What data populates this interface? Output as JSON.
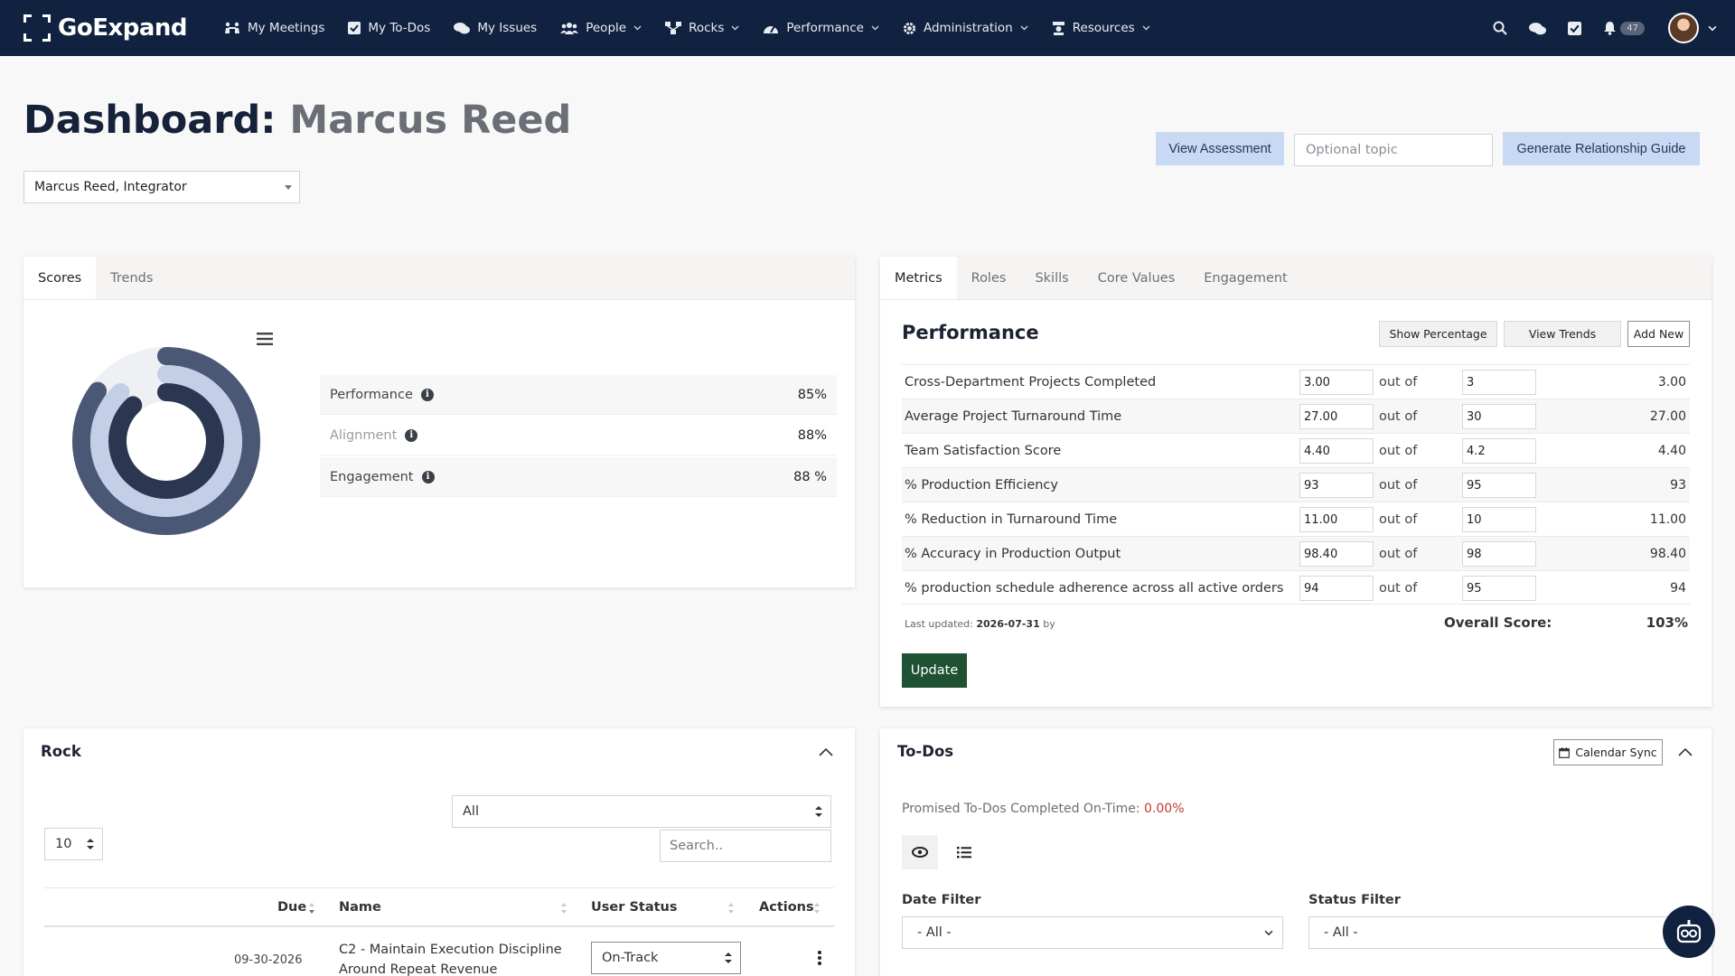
{
  "brand": {
    "name": "GoExpand"
  },
  "nav": {
    "items": [
      {
        "label": "My Meetings",
        "icon": "meetings-icon"
      },
      {
        "label": "My To-Dos",
        "icon": "checkbox-icon"
      },
      {
        "label": "My Issues",
        "icon": "chat-icon"
      },
      {
        "label": "People",
        "icon": "people-icon",
        "dropdown": true
      },
      {
        "label": "Rocks",
        "icon": "hierarchy-icon",
        "dropdown": true
      },
      {
        "label": "Performance",
        "icon": "gauge-icon",
        "dropdown": true
      },
      {
        "label": "Administration",
        "icon": "gear-icon",
        "dropdown": true
      },
      {
        "label": "Resources",
        "icon": "resources-icon",
        "dropdown": true
      }
    ],
    "notification_count": "47"
  },
  "header": {
    "title_prefix": "Dashboard:",
    "title_name": "Marcus Reed",
    "user_select": "Marcus Reed, Integrator",
    "view_assessment": "View Assessment",
    "topic_placeholder": "Optional topic",
    "generate_guide": "Generate Relationship Guide"
  },
  "scores": {
    "tabs": [
      "Scores",
      "Trends"
    ],
    "rows": [
      {
        "label": "Performance",
        "value": "85%"
      },
      {
        "label": "Alignment",
        "value": "88%"
      },
      {
        "label": "Engagement",
        "value": "88 %"
      }
    ],
    "ring_colors": [
      "#4a5876",
      "#c3cfe6",
      "#2b3650"
    ],
    "ring_levels": [
      0.85,
      0.88,
      0.88
    ]
  },
  "metrics": {
    "tabs": [
      "Metrics",
      "Roles",
      "Skills",
      "Core Values",
      "Engagement"
    ],
    "title": "Performance",
    "buttons": {
      "show_percentage": "Show Percentage",
      "view_trends": "View Trends",
      "add_new": "Add New"
    },
    "out_of_label": "out of",
    "rows": [
      {
        "name": "Cross-Department Projects Completed",
        "actual": "3.00",
        "target": "3",
        "result": "3.00"
      },
      {
        "name": "Average Project Turnaround Time",
        "actual": "27.00",
        "target": "30",
        "result": "27.00"
      },
      {
        "name": "Team Satisfaction Score",
        "actual": "4.40",
        "target": "4.2",
        "result": "4.40"
      },
      {
        "name": "% Production Efficiency",
        "actual": "93",
        "target": "95",
        "result": "93"
      },
      {
        "name": "% Reduction in Turnaround Time",
        "actual": "11.00",
        "target": "10",
        "result": "11.00"
      },
      {
        "name": "% Accuracy in Production Output",
        "actual": "98.40",
        "target": "98",
        "result": "98.40"
      },
      {
        "name": "% production schedule adherence across all active orders",
        "actual": "94",
        "target": "95",
        "result": "94"
      }
    ],
    "last_updated_label": "Last updated:",
    "last_updated_date": "2026-07-31",
    "last_updated_by": "by",
    "overall_label": "Overall Score:",
    "overall_value": "103%",
    "update_button": "Update"
  },
  "rock": {
    "title": "Rock",
    "filter": "All",
    "page_size": "10",
    "search_placeholder": "Search..",
    "columns": {
      "due": "Due",
      "name": "Name",
      "status": "User Status",
      "actions": "Actions"
    },
    "rows": [
      {
        "due": "09-30-2026",
        "name": "C2 - Maintain Execution Discipline Around Repeat Revenue",
        "status": "On-Track"
      }
    ]
  },
  "todos": {
    "title": "To-Dos",
    "calendar_sync": "Calendar Sync",
    "promised_label": "Promised To-Dos Completed On-Time:",
    "promised_value": "0.00%",
    "date_filter_label": "Date Filter",
    "date_filter_value": "- All -",
    "status_filter_label": "Status Filter",
    "status_filter_value": "- All -"
  }
}
